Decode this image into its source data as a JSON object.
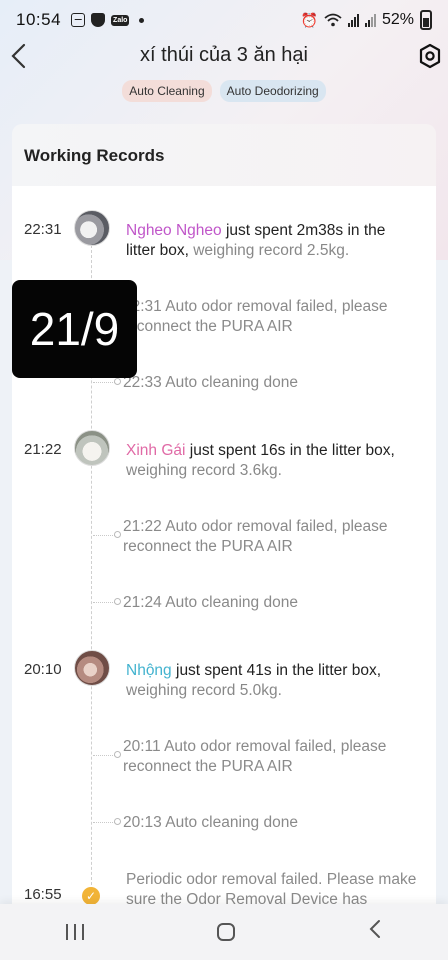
{
  "status_bar": {
    "time": "10:54",
    "battery": "52%",
    "zalo": "Zalo"
  },
  "header": {
    "title": "xí thúi của 3 ăn hại"
  },
  "chips": [
    "Auto Cleaning",
    "Auto Deodorizing"
  ],
  "section_title": "Working Records",
  "overlay_label": "21/9",
  "records": [
    {
      "time": "22:31",
      "name": "Ngheo Ngheo",
      "action": " just spent 2m38s in the litter box,",
      "weight": " weighing record 2.5kg.",
      "subs": [
        {
          "text": "22:31 Auto odor removal failed, please reconnect the PURA AIR"
        },
        {
          "text": "22:33 Auto cleaning done"
        }
      ]
    },
    {
      "time": "21:22",
      "name": "Xinh Gái",
      "action": " just spent 16s in the litter box,",
      "weight": " weighing record 3.6kg.",
      "subs": [
        {
          "text": "21:22 Auto odor removal failed, please reconnect the PURA AIR"
        },
        {
          "text": "21:24 Auto cleaning done"
        }
      ]
    },
    {
      "time": "20:10",
      "name": "Nhộng",
      "action": " just spent 41s in the litter box,",
      "weight": " weighing record 5.0kg.",
      "subs": [
        {
          "text": "20:11 Auto odor removal failed, please reconnect the PURA AIR"
        },
        {
          "text": "20:13 Auto cleaning done"
        }
      ]
    }
  ],
  "last_record": {
    "time": "16:55",
    "text": "Periodic odor removal failed. Please make sure the Odor Removal Device has"
  },
  "colors": {
    "name1": "#c056c9",
    "name2": "#e06aa6",
    "name3": "#43b3cf",
    "warning": "#f2b437"
  }
}
